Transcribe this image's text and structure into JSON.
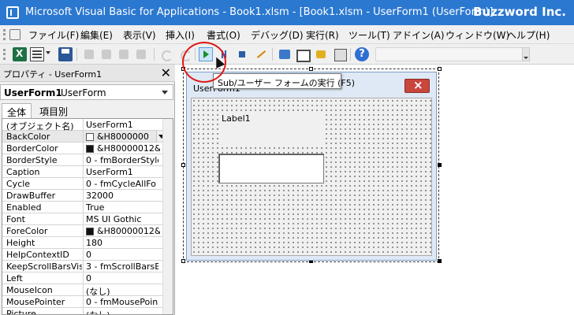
{
  "titlebar": {
    "title": "Microsoft Visual Basic for Applications - Book1.xlsm - [Book1.xlsm - UserForm1 (UserForm)]",
    "brand": "Buzzword Inc."
  },
  "menubar": {
    "items": [
      {
        "label": "ファイル(F)"
      },
      {
        "label": "編集(E)"
      },
      {
        "label": "表示(V)"
      },
      {
        "label": "挿入(I)"
      },
      {
        "label": "書式(O)"
      },
      {
        "label": "デバッグ(D)"
      },
      {
        "label": "実行(R)"
      },
      {
        "label": "ツール(T)"
      },
      {
        "label": "アドイン(A)"
      },
      {
        "label": "ウィンドウ(W)"
      },
      {
        "label": "ヘルプ(H)"
      }
    ]
  },
  "toolbar": {
    "tooltip": "Sub/ユーザー フォームの実行 (F5)"
  },
  "properties": {
    "header": "プロパティ - UserForm1",
    "object_name": "UserForm1",
    "object_type": "UserForm",
    "tabs": [
      "全体",
      "項目別"
    ],
    "rows": [
      {
        "name": "(オブジェクト名)",
        "value": "UserForm1"
      },
      {
        "name": "BackColor",
        "value": "&H8000000",
        "swatch": "light"
      },
      {
        "name": "BorderColor",
        "value": "&H80000012&",
        "swatch": "dark"
      },
      {
        "name": "BorderStyle",
        "value": "0 - fmBorderStyle"
      },
      {
        "name": "Caption",
        "value": "UserForm1"
      },
      {
        "name": "Cycle",
        "value": "0 - fmCycleAllFo"
      },
      {
        "name": "DrawBuffer",
        "value": "32000"
      },
      {
        "name": "Enabled",
        "value": "True"
      },
      {
        "name": "Font",
        "value": "MS UI Gothic"
      },
      {
        "name": "ForeColor",
        "value": "&H80000012&",
        "swatch": "dark"
      },
      {
        "name": "Height",
        "value": "180"
      },
      {
        "name": "HelpContextID",
        "value": "0"
      },
      {
        "name": "KeepScrollBarsVis",
        "value": "3 - fmScrollBarsE"
      },
      {
        "name": "Left",
        "value": "0"
      },
      {
        "name": "MouseIcon",
        "value": "(なし)"
      },
      {
        "name": "MousePointer",
        "value": "0 - fmMousePoin"
      },
      {
        "name": "Picture",
        "value": "(なし)"
      }
    ]
  },
  "userform": {
    "caption": "UserForm1",
    "label_caption": "Label1"
  },
  "colors": {
    "titlebar": "#2b78d0",
    "highlight_circle": "#e01818",
    "run_button": "#1a8f2a"
  }
}
